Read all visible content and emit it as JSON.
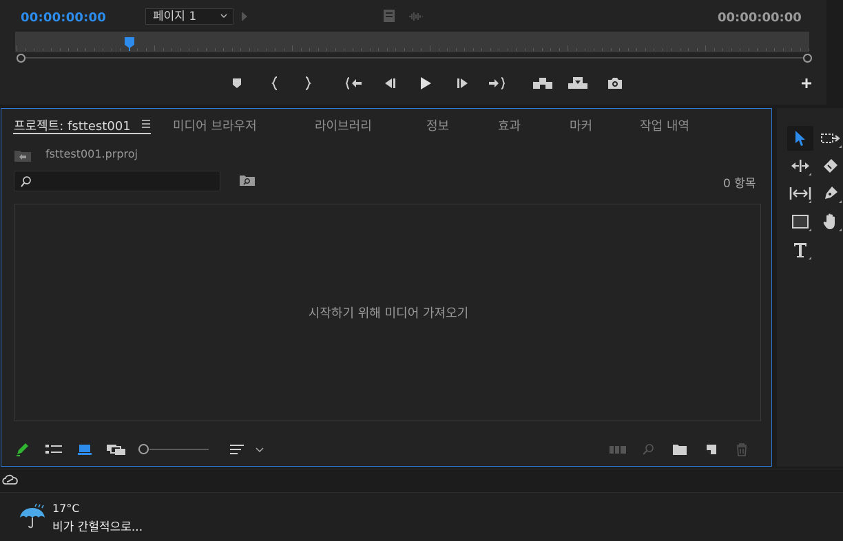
{
  "monitor": {
    "timecode_current": "00:00:00:00",
    "timecode_duration": "00:00:00:00",
    "page_select_value": "페이지 1"
  },
  "project_panel": {
    "tabs": [
      {
        "label": "프로젝트: fsttest001",
        "active": true
      },
      {
        "label": "미디어 브라우저"
      },
      {
        "label": "라이브러리"
      },
      {
        "label": "정보"
      },
      {
        "label": "효과"
      },
      {
        "label": "마커"
      },
      {
        "label": "작업 내역"
      }
    ],
    "breadcrumb": "fsttest001.prproj",
    "search_value": "",
    "item_count": "0 항목",
    "empty_hint": "시작하기 위해 미디어 가져오기"
  },
  "taskbar": {
    "temperature": "17°C",
    "weather": "비가 간헐적으로..."
  },
  "colors": {
    "accent_blue": "#2d8ceb",
    "panel_border": "#2d7bd6",
    "write_on_green": "#2fb52f"
  }
}
